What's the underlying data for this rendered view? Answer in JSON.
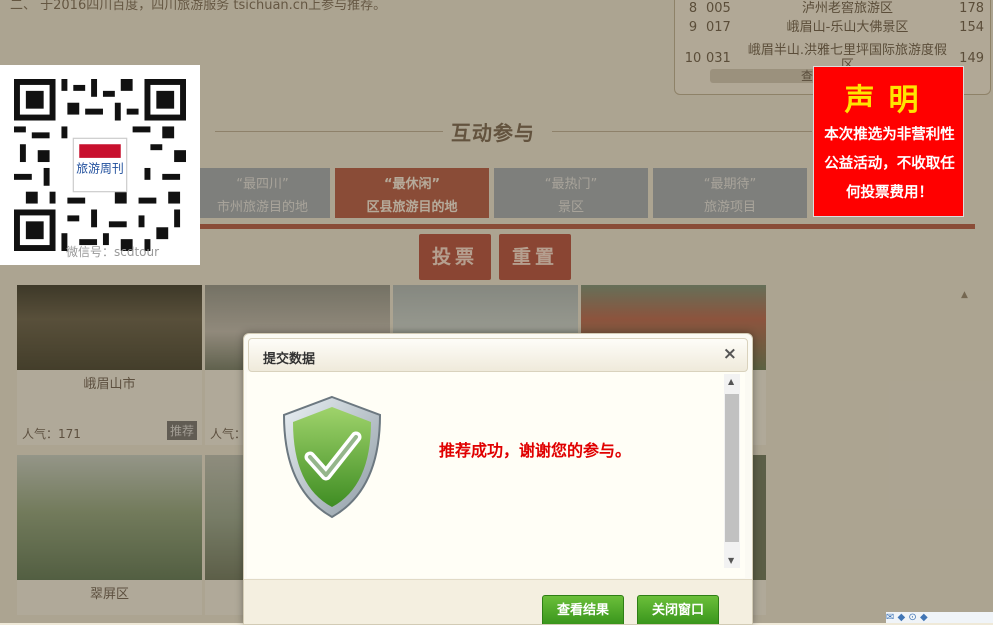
{
  "top_intro": {
    "text": "二、 于2016四川百度，四川旅游服务 tsichuan.cn上参与推荐。"
  },
  "ranking": {
    "rows": [
      {
        "no": "8",
        "code": "005",
        "name": "泸州老窖旅游区",
        "votes": "178"
      },
      {
        "no": "9",
        "code": "017",
        "name": "峨眉山-乐山大佛景区",
        "votes": "154"
      },
      {
        "no": "10",
        "code": "031",
        "name": "峨眉半山.洪雅七里坪国际旅游度假区",
        "votes": "149"
      }
    ],
    "more_label": "查看更多"
  },
  "qr": {
    "brand": "旅游周刊",
    "caption": "微信号：scdtour"
  },
  "section": {
    "title": "互动参与"
  },
  "tabs": [
    {
      "line1": "“最四川”",
      "line2": "市州旅游目的地",
      "active": false
    },
    {
      "line1": "“最休闲”",
      "line2": "区县旅游目的地",
      "active": true
    },
    {
      "line1": "“最热门”",
      "line2": "景区",
      "active": false
    },
    {
      "line1": "“最期待”",
      "line2": "旅游项目",
      "active": false
    }
  ],
  "actions": {
    "vote": "投票",
    "reset": "重置"
  },
  "cards": [
    {
      "name": "峨眉山市",
      "popularity": "人气：171",
      "recommend": "推荐"
    },
    {
      "name": "",
      "popularity": "人气：",
      "recommend": ""
    },
    {
      "name": "",
      "popularity": "",
      "recommend": ""
    },
    {
      "name": "",
      "popularity": "",
      "recommend": ""
    },
    {
      "name": "翠屏区",
      "popularity": "",
      "recommend": ""
    },
    {
      "name": "",
      "popularity": "",
      "recommend": ""
    },
    {
      "name": "",
      "popularity": "",
      "recommend": ""
    }
  ],
  "notice": {
    "title": "声明",
    "body": "本次推选为非营利性公益活动，不收取任何投票费用！"
  },
  "dialog": {
    "title": "提交数据",
    "close_glyph": "×",
    "message": "推荐成功，谢谢您的参与。",
    "view_results": "查看结果",
    "close_window": "关闭窗口"
  },
  "corner_widget": {
    "text": "✉ ◆ ⊙ ◆"
  },
  "colors": {
    "accent_red": "#b14a33",
    "button_green": "#36931a",
    "notice_red": "#ff0000",
    "notice_title": "#ffe300",
    "message_red": "#e00000"
  }
}
